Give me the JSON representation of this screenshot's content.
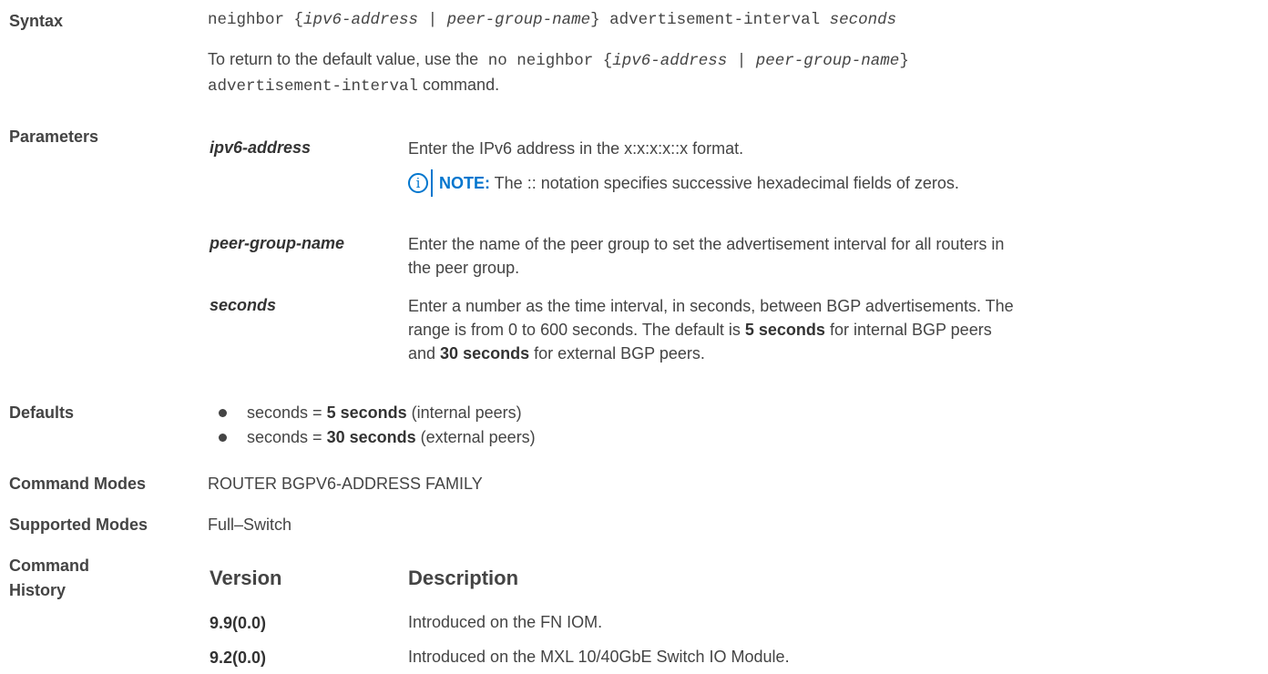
{
  "syntax": {
    "label": "Syntax",
    "cmd_prefix": "neighbor {",
    "arg1": "ipv6-address",
    "sep": " | ",
    "arg2": "peer-group-name",
    "cmd_mid": "} advertisement-interval ",
    "arg3": "seconds",
    "return_text_a": "To return to the default value, use the",
    "return_cmd_a": " no neighbor {",
    "return_arg1": "ipv6-address",
    "return_sep": " | ",
    "return_arg2": "peer-group-name",
    "return_cmd_b": "}",
    "return_cmd_c": "advertisement-interval",
    "return_text_b": " command."
  },
  "parameters": {
    "label": "Parameters",
    "items": [
      {
        "name": "ipv6-address",
        "desc": "Enter the IPv6 address in the x:x:x:x::x format.",
        "note_label": "NOTE:",
        "note_text": " The :: notation specifies successive hexadecimal fields of zeros."
      },
      {
        "name": "peer-group-name",
        "desc_line1": "Enter the name of the peer group to set the advertisement interval for all routers in",
        "desc_line2": "the peer group."
      },
      {
        "name": "seconds",
        "line1": "Enter a number as the time interval, in seconds, between BGP advertisements. The",
        "line2a": "range is from 0 to 600 seconds. The default is ",
        "line2b": "5 seconds",
        "line2c": " for internal BGP peers",
        "line3a": "and ",
        "line3b": "30 seconds",
        "line3c": " for external BGP peers."
      }
    ]
  },
  "defaults": {
    "label": "Defaults",
    "items": [
      {
        "a": "seconds = ",
        "b": "5 seconds",
        "c": " (internal peers)"
      },
      {
        "a": "seconds = ",
        "b": "30 seconds",
        "c": " (external peers)"
      }
    ]
  },
  "command_modes": {
    "label": "Command Modes",
    "value": "ROUTER BGPV6-ADDRESS FAMILY"
  },
  "supported_modes": {
    "label": "Supported Modes",
    "value": "Full–Switch"
  },
  "command_history": {
    "label_line1": "Command",
    "label_line2": "History",
    "col_version": "Version",
    "col_description": "Description",
    "rows": [
      {
        "version": "9.9(0.0)",
        "description": "Introduced on the FN IOM."
      },
      {
        "version": "9.2(0.0)",
        "description": "Introduced on the MXL 10/40GbE Switch IO Module."
      }
    ]
  }
}
